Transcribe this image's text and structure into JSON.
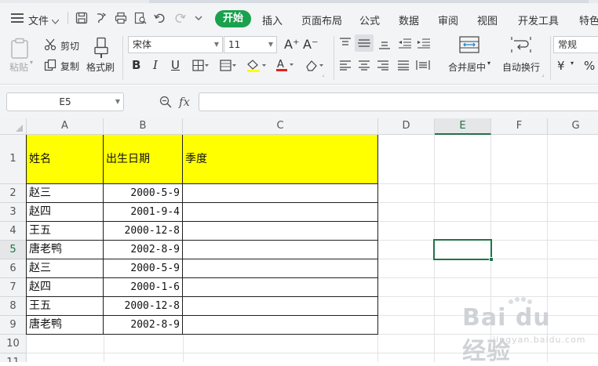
{
  "menubar": {
    "file_label": "文件",
    "tabs": [
      "开始",
      "插入",
      "页面布局",
      "公式",
      "数据",
      "审阅",
      "视图",
      "开发工具",
      "特色"
    ]
  },
  "ribbon": {
    "paste_label": "粘贴",
    "cut_label": "剪切",
    "copy_label": "复制",
    "format_painter_label": "格式刷",
    "font_name": "宋体",
    "font_size": "11",
    "merge_center_label": "合并居中",
    "wrap_text_label": "自动换行",
    "number_format": "常规",
    "currency_symbol": "¥",
    "percent_symbol": "%"
  },
  "formula_bar": {
    "name_box": "E5",
    "fx_label": "fx",
    "formula_value": ""
  },
  "sheet": {
    "columns": [
      "A",
      "B",
      "C",
      "D",
      "E",
      "F",
      "G"
    ],
    "selected_column": "E",
    "selected_row": "5",
    "rows": [
      "1",
      "2",
      "3",
      "4",
      "5",
      "6",
      "7",
      "8",
      "9",
      "10",
      "11"
    ],
    "header_row": [
      "姓名",
      "出生日期",
      "季度"
    ],
    "data": [
      [
        "赵三",
        "2000-5-9",
        ""
      ],
      [
        "赵四",
        "2001-9-4",
        ""
      ],
      [
        "王五",
        "2000-12-8",
        ""
      ],
      [
        "唐老鸭",
        "2002-8-9",
        ""
      ],
      [
        "赵三",
        "2000-5-9",
        ""
      ],
      [
        "赵四",
        "2000-1-6",
        ""
      ],
      [
        "王五",
        "2000-12-8",
        ""
      ],
      [
        "唐老鸭",
        "2002-8-9",
        ""
      ]
    ]
  },
  "colors": {
    "accent": "#1aa14d",
    "selection": "#217346",
    "header_fill": "#ffff00"
  }
}
